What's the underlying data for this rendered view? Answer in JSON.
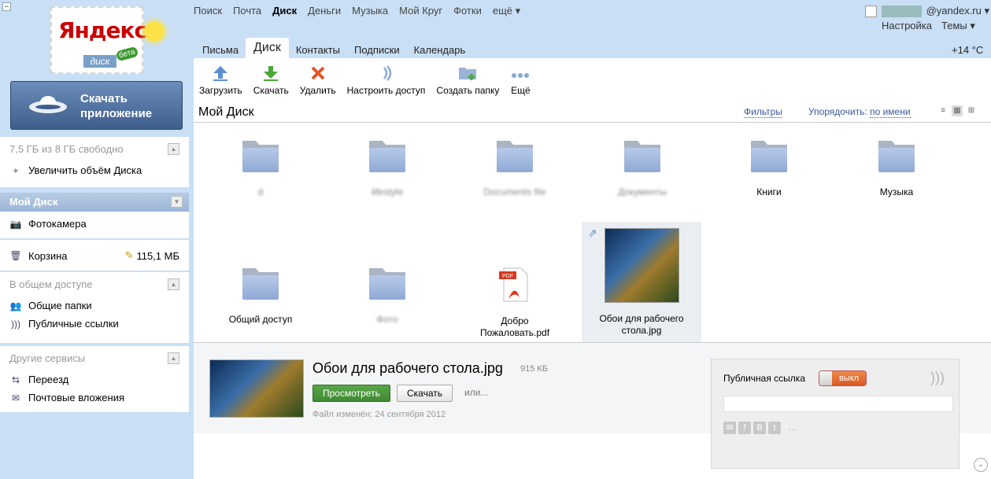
{
  "header": {
    "services": [
      "Поиск",
      "Почта",
      "Диск",
      "Деньги",
      "Музыка",
      "Мой Круг",
      "Фотки",
      "ещё ▾"
    ],
    "active_service": "Диск",
    "user_email": "@yandex.ru ▾",
    "settings": "Настройка",
    "themes": "Темы ▾",
    "temperature": "+14 °С",
    "tabs": [
      "Письма",
      "Диск",
      "Контакты",
      "Подписки",
      "Календарь"
    ]
  },
  "logo": {
    "brand": "Яндекс",
    "product": "диск",
    "badge": "бета"
  },
  "promo": {
    "line1": "Скачать",
    "line2": "приложение"
  },
  "sidebar": {
    "quota": "7,5 ГБ из 8 ГБ свободно",
    "increase": "Увеличить объём Диска",
    "my_disk": "Мой Диск",
    "camera": "Фотокамера",
    "trash": "Корзина",
    "trash_size": "115,1 МБ",
    "shared_header": "В общем доступе",
    "shared_folders": "Общие папки",
    "public_links": "Публичные ссылки",
    "other_header": "Другие сервисы",
    "move": "Переезд",
    "mail_attachments": "Почтовые вложения"
  },
  "toolbar": {
    "upload": "Загрузить",
    "download": "Скачать",
    "delete": "Удалить",
    "share": "Настроить доступ",
    "new_folder": "Создать папку",
    "more": "Ещё"
  },
  "main": {
    "title": "Мой Диск",
    "filters": "Фильтры",
    "sort_label": "Упорядочить:",
    "sort_value": "по имени"
  },
  "files": [
    {
      "name": "d",
      "type": "folder",
      "obscured": true
    },
    {
      "name": "lifestyle",
      "type": "folder",
      "obscured": true
    },
    {
      "name": "Documents file",
      "type": "folder",
      "obscured": true
    },
    {
      "name": "Документы",
      "type": "folder",
      "obscured": true
    },
    {
      "name": "Книги",
      "type": "folder"
    },
    {
      "name": "Музыка",
      "type": "folder"
    },
    {
      "name": "Общий доступ",
      "type": "folder"
    },
    {
      "name": "Фото",
      "type": "folder",
      "obscured": true
    },
    {
      "name": "Добро Пожаловать.pdf",
      "type": "pdf"
    },
    {
      "name": "Обои для рабочего стола.jpg",
      "type": "image",
      "selected": true
    }
  ],
  "detail": {
    "title": "Обои для рабочего стола.jpg",
    "size": "915 КБ",
    "view_button": "Просмотреть",
    "download_button": "Скачать",
    "or": "или...",
    "modified": "Файл изменён: 24 сентября 2012",
    "public_link_label": "Публичная ссылка",
    "toggle_state": "выкл"
  },
  "colors": {
    "accent_green": "#3f8a32",
    "toggle_orange": "#d85a23",
    "link_blue": "#3b5998",
    "brand_red": "#cc0000"
  }
}
